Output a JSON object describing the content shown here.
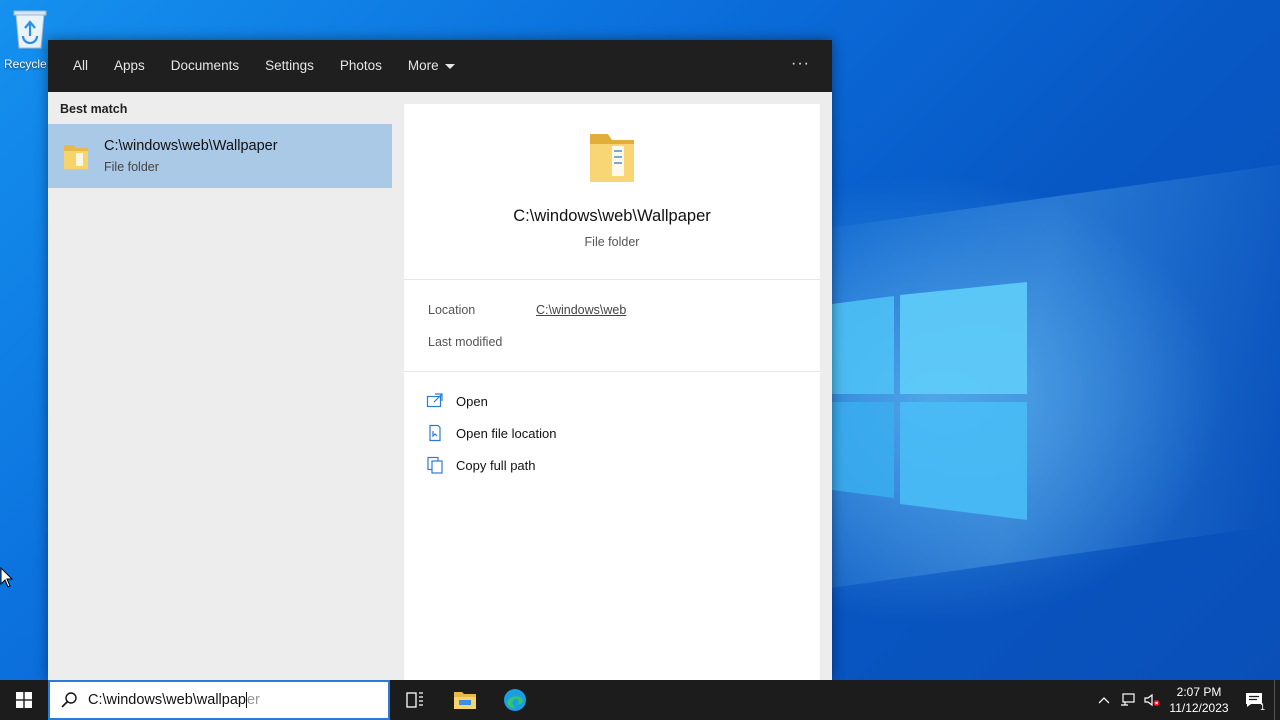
{
  "desktop": {
    "recycle_bin_label": "Recycle Bin"
  },
  "search_panel": {
    "tabs": [
      {
        "label": "All"
      },
      {
        "label": "Apps"
      },
      {
        "label": "Documents"
      },
      {
        "label": "Settings"
      },
      {
        "label": "Photos"
      },
      {
        "label": "More"
      }
    ],
    "overflow_label": "···",
    "best_match_heading": "Best match",
    "result": {
      "title": "C:\\windows\\web\\Wallpaper",
      "subtitle": "File folder"
    },
    "preview": {
      "title": "C:\\windows\\web\\Wallpaper",
      "type": "File folder"
    },
    "details": {
      "location_label": "Location",
      "location_value": "C:\\windows\\web",
      "modified_label": "Last modified"
    },
    "actions": [
      {
        "label": "Open",
        "icon": "open-icon"
      },
      {
        "label": "Open file location",
        "icon": "file-location-icon"
      },
      {
        "label": "Copy full path",
        "icon": "copy-icon"
      }
    ]
  },
  "taskbar": {
    "search_value": "C:\\windows\\web\\wallpap",
    "search_completion": "er",
    "clock_time": "2:07 PM",
    "clock_date": "11/12/2023",
    "notification_count": "1"
  },
  "colors": {
    "accent": "#2b7bd6",
    "selected_result": "#a9c9e6",
    "panel_header": "#1f1f1f",
    "taskbar": "#1c1c1c"
  }
}
